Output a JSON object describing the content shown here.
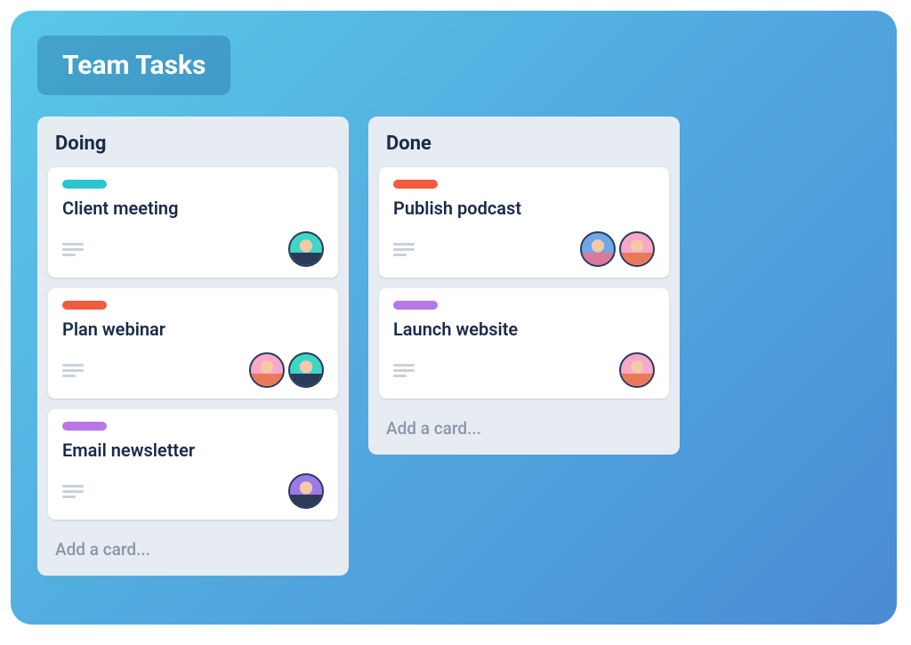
{
  "board": {
    "title": "Team Tasks",
    "add_card_label": "Add a card...",
    "label_colors": {
      "teal": "#2bc4d1",
      "red": "#f25b3f",
      "purple": "#b876e9"
    },
    "lists": [
      {
        "title": "Doing",
        "cards": [
          {
            "title": "Client meeting",
            "label": "teal",
            "has_description": true,
            "avatars": [
              "teal"
            ]
          },
          {
            "title": "Plan webinar",
            "label": "red",
            "has_description": true,
            "avatars": [
              "pink",
              "teal"
            ]
          },
          {
            "title": "Email newsletter",
            "label": "purple",
            "has_description": true,
            "avatars": [
              "purple"
            ]
          }
        ]
      },
      {
        "title": "Done",
        "cards": [
          {
            "title": "Publish podcast",
            "label": "red",
            "has_description": true,
            "avatars": [
              "blue",
              "pink"
            ]
          },
          {
            "title": "Launch website",
            "label": "purple",
            "has_description": true,
            "avatars": [
              "pink"
            ]
          }
        ]
      }
    ]
  }
}
